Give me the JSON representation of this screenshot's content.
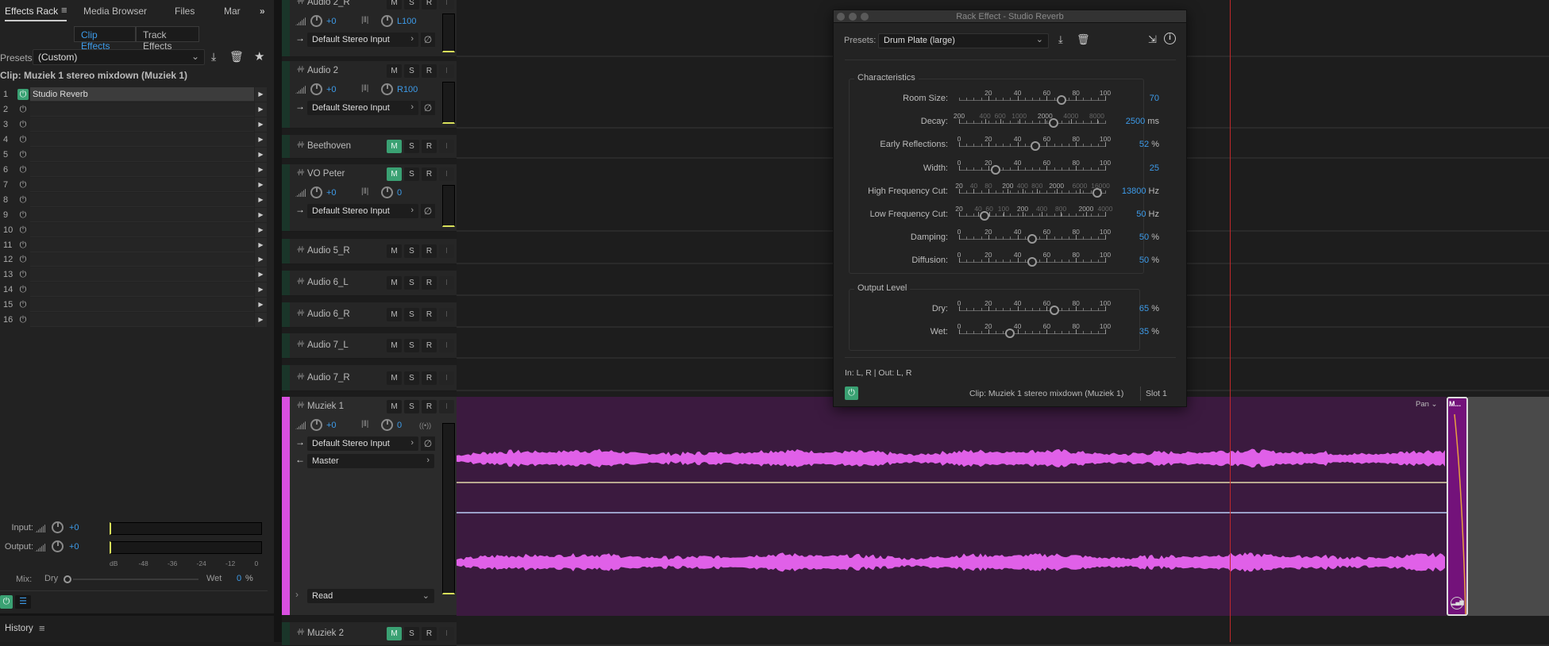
{
  "left_panel": {
    "tabs": [
      {
        "label": "Effects Rack",
        "active": true
      },
      {
        "label": "Media Browser"
      },
      {
        "label": "Files"
      },
      {
        "label": "Mar"
      }
    ],
    "overflow_icon": "double-chevron-right-icon",
    "segments": [
      "Clip Effects",
      "Track Effects"
    ],
    "active_segment": "Clip Effects",
    "presets_label": "Presets:",
    "presets_value": "(Custom)",
    "clip_label": "Clip: Muziek 1 stereo mixdown (Muziek 1)",
    "slots": [
      {
        "n": "1",
        "name": "Studio Reverb",
        "on": true
      },
      {
        "n": "2",
        "name": ""
      },
      {
        "n": "3",
        "name": ""
      },
      {
        "n": "4",
        "name": ""
      },
      {
        "n": "5",
        "name": ""
      },
      {
        "n": "6",
        "name": ""
      },
      {
        "n": "7",
        "name": ""
      },
      {
        "n": "8",
        "name": ""
      },
      {
        "n": "9",
        "name": ""
      },
      {
        "n": "10",
        "name": ""
      },
      {
        "n": "11",
        "name": ""
      },
      {
        "n": "12",
        "name": ""
      },
      {
        "n": "13",
        "name": ""
      },
      {
        "n": "14",
        "name": ""
      },
      {
        "n": "15",
        "name": ""
      },
      {
        "n": "16",
        "name": ""
      }
    ],
    "input_label": "Input:",
    "input_value": "+0",
    "output_label": "Output:",
    "output_value": "+0",
    "db_scale": [
      "dB",
      "-48",
      "-36",
      "-24",
      "-12",
      "0"
    ],
    "mix_label": "Mix:",
    "mix_dry": "Dry",
    "mix_wet": "Wet",
    "mix_value": "0",
    "mix_unit": "%",
    "history_label": "History"
  },
  "tracks": [
    {
      "name": "Audio 2_R",
      "vol": "+0",
      "pan": "L100",
      "input": "Default Stereo Input",
      "mute": false
    },
    {
      "name": "Audio 2",
      "vol": "+0",
      "pan": "R100",
      "input": "Default Stereo Input",
      "mute": false
    },
    {
      "name": "Beethoven",
      "mute": true
    },
    {
      "name": "VO Peter",
      "vol": "+0",
      "pan": "0",
      "input": "Default Stereo Input",
      "mute": true
    },
    {
      "name": "Audio 5_R",
      "mute": false
    },
    {
      "name": "Audio 6_L",
      "mute": false
    },
    {
      "name": "Audio 6_R",
      "mute": false
    },
    {
      "name": "Audio 7_L",
      "mute": false
    },
    {
      "name": "Audio 7_R",
      "mute": false
    },
    {
      "name": "Muziek 1",
      "vol": "+0",
      "pan": "0",
      "input": "Default Stereo Input",
      "output": "Master",
      "automation": "Read",
      "mute": false,
      "selected": true
    },
    {
      "name": "Muziek 2",
      "mute": true
    }
  ],
  "track_buttons": [
    "M",
    "S",
    "R",
    "I"
  ],
  "timeline": {
    "clip_color": "#3b1a3f",
    "waveform_color": "#e060e8",
    "pan_dropdown": "Pan",
    "small_clip_label": "M..."
  },
  "dialog": {
    "title": "Rack Effect - Studio Reverb",
    "presets_label": "Presets:",
    "presets_value": "Drum Plate (large)",
    "characteristics_label": "Characteristics",
    "output_level_label": "Output Level",
    "sliders": [
      {
        "label": "Room Size:",
        "value": 70,
        "display": "70",
        "unit": "",
        "scale": "linear",
        "min": 0,
        "max": 100,
        "ticks": [
          {
            "v": 20,
            "t": "20"
          },
          {
            "v": 40,
            "t": "40"
          },
          {
            "v": 60,
            "t": "60"
          },
          {
            "v": 80,
            "t": "80"
          },
          {
            "v": 100,
            "t": "100"
          }
        ]
      },
      {
        "label": "Decay:",
        "value": 2500,
        "display": "2500",
        "unit": "ms",
        "scale": "log",
        "min": 200,
        "max": 10000,
        "ticks": [
          {
            "v": 200,
            "t": "200",
            "major": true
          },
          {
            "v": 400,
            "t": "400"
          },
          {
            "v": 600,
            "t": "600"
          },
          {
            "v": 1000,
            "t": "1000"
          },
          {
            "v": 2000,
            "t": "2000",
            "major": true
          },
          {
            "v": 4000,
            "t": "4000"
          },
          {
            "v": 8000,
            "t": "8000"
          }
        ]
      },
      {
        "label": "Early Reflections:",
        "value": 52,
        "display": "52",
        "unit": "%",
        "scale": "linear",
        "min": 0,
        "max": 100,
        "ticks": [
          {
            "v": 0,
            "t": "0"
          },
          {
            "v": 20,
            "t": "20"
          },
          {
            "v": 40,
            "t": "40"
          },
          {
            "v": 60,
            "t": "60"
          },
          {
            "v": 80,
            "t": "80"
          },
          {
            "v": 100,
            "t": "100"
          }
        ]
      },
      {
        "label": "Width:",
        "value": 25,
        "display": "25",
        "unit": "",
        "scale": "linear",
        "min": 0,
        "max": 100,
        "ticks": [
          {
            "v": 0,
            "t": "0"
          },
          {
            "v": 20,
            "t": "20"
          },
          {
            "v": 40,
            "t": "40"
          },
          {
            "v": 60,
            "t": "60"
          },
          {
            "v": 80,
            "t": "80"
          },
          {
            "v": 100,
            "t": "100"
          }
        ]
      },
      {
        "label": "High Frequency Cut:",
        "value": 13800,
        "display": "13800",
        "unit": "Hz",
        "scale": "log",
        "min": 20,
        "max": 20000,
        "ticks": [
          {
            "v": 20,
            "t": "20",
            "major": true
          },
          {
            "v": 40,
            "t": "40"
          },
          {
            "v": 80,
            "t": "80"
          },
          {
            "v": 200,
            "t": "200",
            "major": true
          },
          {
            "v": 400,
            "t": "400"
          },
          {
            "v": 800,
            "t": "800"
          },
          {
            "v": 2000,
            "t": "2000",
            "major": true
          },
          {
            "v": 6000,
            "t": "6000"
          },
          {
            "v": 16000,
            "t": "16000"
          }
        ]
      },
      {
        "label": "Low Frequency Cut:",
        "value": 50,
        "display": "50",
        "unit": "Hz",
        "scale": "log",
        "min": 20,
        "max": 4000,
        "ticks": [
          {
            "v": 20,
            "t": "20",
            "major": true
          },
          {
            "v": 40,
            "t": "40"
          },
          {
            "v": 60,
            "t": "60"
          },
          {
            "v": 100,
            "t": "100"
          },
          {
            "v": 200,
            "t": "200",
            "major": true
          },
          {
            "v": 400,
            "t": "400"
          },
          {
            "v": 800,
            "t": "800"
          },
          {
            "v": 2000,
            "t": "2000",
            "major": true
          },
          {
            "v": 4000,
            "t": "4000"
          }
        ]
      },
      {
        "label": "Damping:",
        "value": 50,
        "display": "50",
        "unit": "%",
        "scale": "linear",
        "min": 0,
        "max": 100,
        "ticks": [
          {
            "v": 0,
            "t": "0"
          },
          {
            "v": 20,
            "t": "20"
          },
          {
            "v": 40,
            "t": "40"
          },
          {
            "v": 60,
            "t": "60"
          },
          {
            "v": 80,
            "t": "80"
          },
          {
            "v": 100,
            "t": "100"
          }
        ]
      },
      {
        "label": "Diffusion:",
        "value": 50,
        "display": "50",
        "unit": "%",
        "scale": "linear",
        "min": 0,
        "max": 100,
        "ticks": [
          {
            "v": 0,
            "t": "0"
          },
          {
            "v": 20,
            "t": "20"
          },
          {
            "v": 40,
            "t": "40"
          },
          {
            "v": 60,
            "t": "60"
          },
          {
            "v": 80,
            "t": "80"
          },
          {
            "v": 100,
            "t": "100"
          }
        ]
      }
    ],
    "output_sliders": [
      {
        "label": "Dry:",
        "value": 65,
        "display": "65",
        "unit": "%",
        "scale": "linear",
        "min": 0,
        "max": 100,
        "ticks": [
          {
            "v": 0,
            "t": "0"
          },
          {
            "v": 20,
            "t": "20"
          },
          {
            "v": 40,
            "t": "40"
          },
          {
            "v": 60,
            "t": "60"
          },
          {
            "v": 80,
            "t": "80"
          },
          {
            "v": 100,
            "t": "100"
          }
        ]
      },
      {
        "label": "Wet:",
        "value": 35,
        "display": "35",
        "unit": "%",
        "scale": "linear",
        "min": 0,
        "max": 100,
        "ticks": [
          {
            "v": 0,
            "t": "0"
          },
          {
            "v": 20,
            "t": "20"
          },
          {
            "v": 40,
            "t": "40"
          },
          {
            "v": 60,
            "t": "60"
          },
          {
            "v": 80,
            "t": "80"
          },
          {
            "v": 100,
            "t": "100"
          }
        ]
      }
    ],
    "io_label": "In: L, R | Out: L, R",
    "clip_label": "Clip: Muziek 1 stereo mixdown (Muziek 1)",
    "slot_label": "Slot 1"
  },
  "colors": {
    "accent": "#3d9be9",
    "power_on": "#3aa173",
    "playhead": "#c0282b",
    "track_strip": "#d94fe0"
  }
}
